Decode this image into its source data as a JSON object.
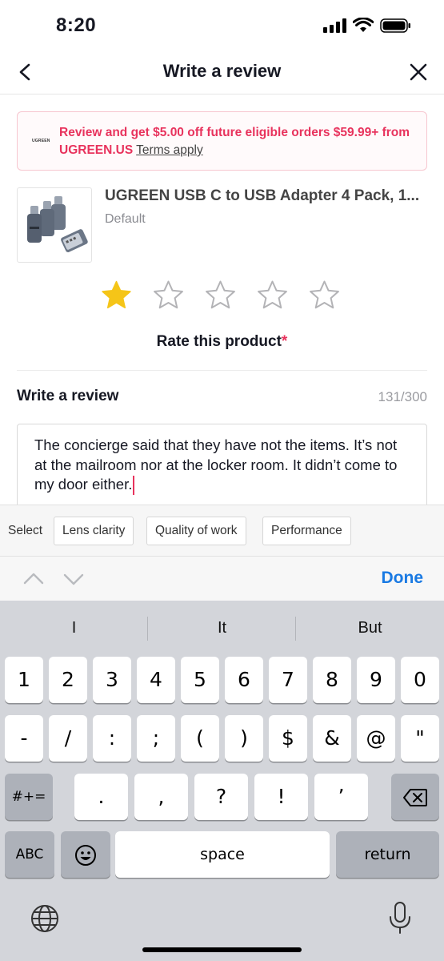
{
  "status_bar": {
    "time": "8:20"
  },
  "header": {
    "title": "Write a review"
  },
  "promo": {
    "logo": "UGREEN",
    "text": "Review and get $5.00 off future eligible orders $59.99+ from UGREEN.US",
    "terms": "Terms apply"
  },
  "product": {
    "title": "UGREEN USB C to USB Adapter 4 Pack, 1...",
    "variant": "Default"
  },
  "rating": {
    "value": 1,
    "max": 5,
    "label": "Rate this product",
    "required_mark": "*"
  },
  "review": {
    "label": "Write a review",
    "count": "131/300",
    "text": "The concierge said that they have not the items. It’s not at the mailroom nor at the locker room. It didn’t come to my door either."
  },
  "tags": {
    "select_label": "Select",
    "chips": [
      "Lens clarity",
      "Quality of work",
      "Performance"
    ]
  },
  "accessory": {
    "done_label": "Done"
  },
  "keyboard": {
    "suggestions": [
      "I",
      "It",
      "But"
    ],
    "row1": [
      "1",
      "2",
      "3",
      "4",
      "5",
      "6",
      "7",
      "8",
      "9",
      "0"
    ],
    "row2": [
      "-",
      "/",
      ":",
      ";",
      "(",
      ")",
      "$",
      "&",
      "@",
      "\""
    ],
    "row3_left": "#+=",
    "row3": [
      ".",
      ",",
      "?",
      "!",
      "’"
    ],
    "abc_label": "ABC",
    "space_label": "space",
    "return_label": "return"
  },
  "colors": {
    "accent": "#e8335d",
    "star_filled": "#f5c518",
    "link_blue": "#1a7ae3"
  }
}
